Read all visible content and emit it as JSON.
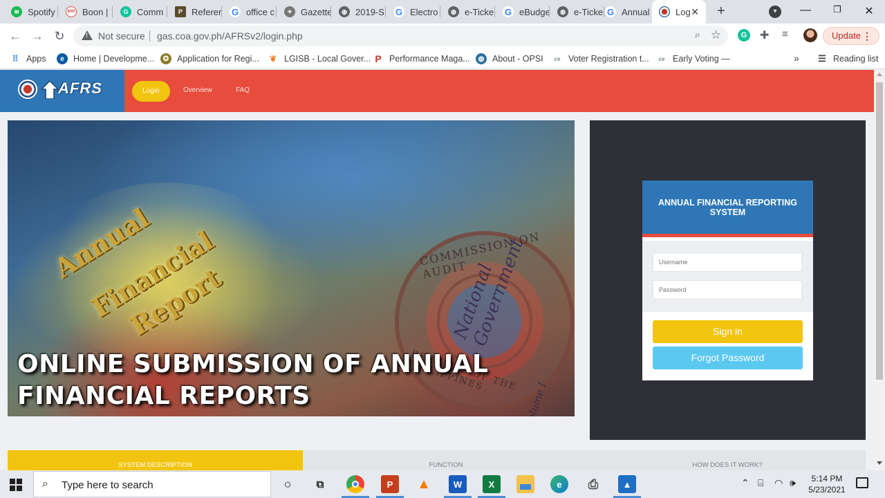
{
  "browser": {
    "tabs": [
      {
        "title": "Spotify",
        "icon": "spotify-icon",
        "color": "#1db954"
      },
      {
        "title": "Boon |",
        "icon": "boon-icon",
        "color": "#d9534f"
      },
      {
        "title": "Comm",
        "icon": "grammarly-icon",
        "color": "#15c39a"
      },
      {
        "title": "Referer",
        "icon": "reference-icon",
        "color": "#5a4a2a"
      },
      {
        "title": "office c",
        "icon": "google-icon",
        "color": "#4285f4"
      },
      {
        "title": "Gazette",
        "icon": "gazette-icon",
        "color": "#555555"
      },
      {
        "title": "2019-S",
        "icon": "globe-icon",
        "color": "#5f6368"
      },
      {
        "title": "Electro",
        "icon": "google-icon",
        "color": "#4285f4"
      },
      {
        "title": "e-Ticke",
        "icon": "globe-icon",
        "color": "#5f6368"
      },
      {
        "title": "eBudge",
        "icon": "google-icon",
        "color": "#4285f4"
      },
      {
        "title": "e-Ticke",
        "icon": "globe-icon",
        "color": "#5f6368"
      },
      {
        "title": "Annual",
        "icon": "google-icon",
        "color": "#4285f4"
      },
      {
        "title": "Log",
        "icon": "coa-seal-icon",
        "color": "#c0392b"
      }
    ],
    "security_label": "Not secure",
    "url": "gas.coa.gov.ph/AFRSv2/login.php",
    "update_label": "Update",
    "bookmarks": [
      {
        "label": "Apps",
        "icon": "apps-grid-icon",
        "color": "#4285f4"
      },
      {
        "label": "Home | Developme...",
        "icon": "edge-icon",
        "color": "#0c59a4"
      },
      {
        "label": "Application for Regi...",
        "icon": "seal-icon",
        "color": "#8a7a2a"
      },
      {
        "label": "LGISB - Local Gover...",
        "icon": "lgisb-icon",
        "color": "#e67e22"
      },
      {
        "label": "Performance Maga...",
        "icon": "performance-icon",
        "color": "#c0392b"
      },
      {
        "label": "About - OPSI",
        "icon": "globe-icon",
        "color": "#2c6e9e"
      },
      {
        "label": "Voter Registration t...",
        "icon": "comelec-icon",
        "color": "#7f8c8d"
      },
      {
        "label": "Early Voting —",
        "icon": "comelec-icon",
        "color": "#7f8c8d"
      }
    ],
    "reading_list": "Reading list"
  },
  "site": {
    "logo_text": "AFRS",
    "nav": {
      "login": "Login",
      "overview": "Overview",
      "faq": "FAQ"
    },
    "hero": {
      "title": "ONLINE SUBMISSION OF ANNUAL FINANCIAL REPORTS",
      "cover_words": [
        "Annual",
        "Financial",
        "Report"
      ],
      "seal_top": "COMMISSION ON AUDIT",
      "seal_bottom": "REPUBLIC OF THE PHILIPPINES",
      "seal_overlay": "National Government",
      "seal_volume": "Volume I"
    },
    "login": {
      "title": "ANNUAL FINANCIAL REPORTING SYSTEM",
      "username_placeholder": "Username",
      "password_placeholder": "Password",
      "signin_label": "Sign in",
      "forgot_label": "Forgot Password"
    },
    "info_tabs": [
      "SYSTEM DESCRIPTION",
      "FUNCTION",
      "HOW DOES IT WORK?"
    ],
    "colors": {
      "header_red": "#e74c3c",
      "brand_blue": "#2e76b6",
      "accent_yellow": "#f1c40f",
      "panel_dark": "#2f3037",
      "forgot_blue": "#5bc8f0"
    }
  },
  "taskbar": {
    "search_placeholder": "Type here to search",
    "apps": [
      {
        "name": "cortana-icon"
      },
      {
        "name": "task-view-icon"
      },
      {
        "name": "chrome-icon"
      },
      {
        "name": "powerpoint-icon"
      },
      {
        "name": "vlc-icon"
      },
      {
        "name": "word-icon"
      },
      {
        "name": "excel-icon"
      },
      {
        "name": "file-explorer-icon"
      },
      {
        "name": "edge-icon"
      },
      {
        "name": "scanner-icon"
      },
      {
        "name": "photos-icon"
      }
    ],
    "time": "5:14 PM",
    "date": "5/23/2021"
  }
}
